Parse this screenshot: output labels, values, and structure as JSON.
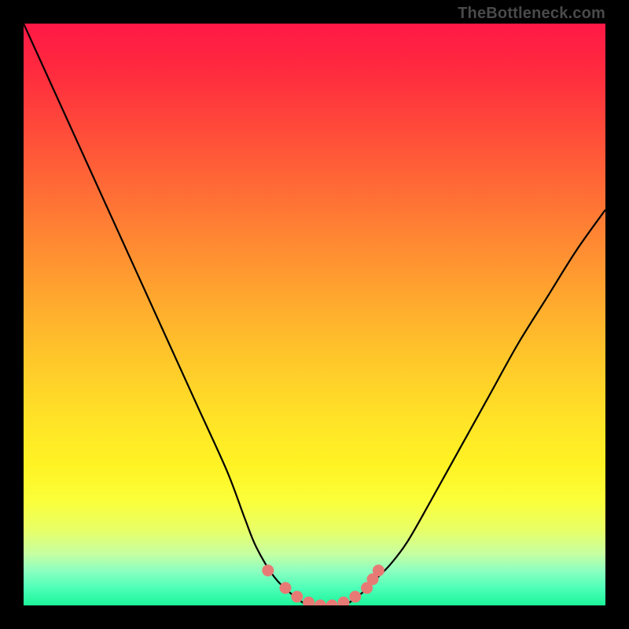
{
  "watermark": "TheBottleneck.com",
  "chart_data": {
    "type": "line",
    "title": "",
    "xlabel": "",
    "ylabel": "",
    "xlim": [
      0,
      100
    ],
    "ylim": [
      0,
      100
    ],
    "series": [
      {
        "name": "bottleneck-curve",
        "x": [
          0,
          5,
          10,
          15,
          20,
          25,
          30,
          35,
          38,
          40,
          43,
          46,
          49,
          52,
          55,
          58,
          60,
          63,
          66,
          70,
          75,
          80,
          85,
          90,
          95,
          100
        ],
        "y": [
          100,
          89,
          78,
          67,
          56,
          45,
          34,
          23,
          15,
          10,
          5,
          2,
          0,
          0,
          0,
          2,
          4,
          7,
          11,
          18,
          27,
          36,
          45,
          53,
          61,
          68
        ]
      }
    ],
    "markers": {
      "name": "trough-markers",
      "color": "#e77a74",
      "x": [
        42,
        45,
        47,
        49,
        51,
        53,
        55,
        57,
        59,
        60,
        61
      ],
      "y": [
        6,
        3,
        1.5,
        0.5,
        0,
        0,
        0.5,
        1.5,
        3,
        4.5,
        6
      ]
    }
  }
}
